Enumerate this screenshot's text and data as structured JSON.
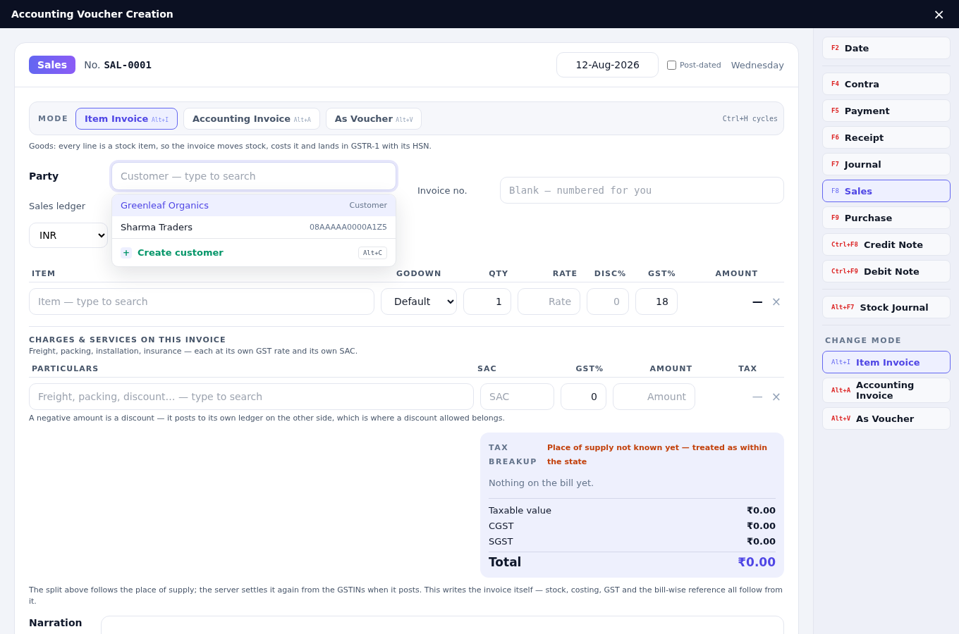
{
  "window": {
    "title": "Accounting Voucher Creation",
    "close": "×"
  },
  "header": {
    "voucher_type": "Sales",
    "number_label": "No.",
    "number": "SAL-0001",
    "date": "12-Aug-2026",
    "post_dated": {
      "label": "Post-dated",
      "checked": false
    },
    "weekday": "Wednesday"
  },
  "mode": {
    "label": "MODE",
    "options": [
      {
        "label": "Item Invoice",
        "shortcut": "Alt+I",
        "selected": true
      },
      {
        "label": "Accounting Invoice",
        "shortcut": "Alt+A",
        "selected": false
      },
      {
        "label": "As Voucher",
        "shortcut": "Alt+V",
        "selected": false
      }
    ],
    "hint": "Ctrl+H cycles",
    "description": "Goods: every line is a stock item, so the invoice moves stock, costs it and lands in GSTR-1 with its HSN."
  },
  "party": {
    "label": "Party",
    "placeholder": "Customer — type to search",
    "suggestions": [
      {
        "name": "Greenleaf Organics",
        "detail": "Customer",
        "selected": true
      },
      {
        "name": "Sharma Traders",
        "detail": "08AAAAA0000A1Z5",
        "selected": false
      }
    ],
    "create": {
      "icon": "+",
      "label": "Create customer",
      "shortcut": "Alt+C"
    }
  },
  "sales_ledger": {
    "label": "Sales ledger"
  },
  "invoice_no": {
    "label": "Invoice no.",
    "placeholder": "Blank — numbered for you"
  },
  "currency": "INR",
  "items": {
    "columns": [
      "ITEM",
      "GODOWN",
      "QTY",
      "RATE",
      "DISC%",
      "GST%",
      "AMOUNT"
    ],
    "row": {
      "item_placeholder": "Item — type to search",
      "godown": "Default",
      "qty": "1",
      "rate_placeholder": "Rate",
      "disc_placeholder": "0",
      "gst": "18",
      "amount": "—",
      "remove": "×"
    }
  },
  "charges": {
    "title": "CHARGES & SERVICES ON THIS INVOICE",
    "description": "Freight, packing, installation, insurance — each at its own GST rate and its own SAC.",
    "columns": [
      "PARTICULARS",
      "SAC",
      "GST%",
      "AMOUNT",
      "TAX"
    ],
    "row": {
      "particulars_placeholder": "Freight, packing, discount… — type to search",
      "sac_placeholder": "SAC",
      "gst": "0",
      "amount_placeholder": "Amount",
      "tax": "—",
      "remove": "×"
    },
    "note": "A negative amount is a discount — it posts to its own ledger on the other side, which is where a discount allowed belongs."
  },
  "tax_breakup": {
    "title": "TAX BREAKUP",
    "warning": "Place of supply not known yet — treated as within the state",
    "empty": "Nothing on the bill yet.",
    "lines": [
      {
        "label": "Taxable value",
        "value": "₹0.00"
      },
      {
        "label": "CGST",
        "value": "₹0.00"
      },
      {
        "label": "SGST",
        "value": "₹0.00"
      }
    ],
    "total": {
      "label": "Total",
      "value": "₹0.00"
    }
  },
  "footnote": "The split above follows the place of supply; the server settles it again from the GSTINs when it posts. This writes the invoice itself — stock, costing, GST and the bill-wise reference all follow from it.",
  "narration": {
    "label": "Narration"
  },
  "sidebar": {
    "groups": [
      {
        "items": [
          {
            "key": "F2",
            "label": "Date",
            "selected": false
          }
        ]
      },
      {
        "items": [
          {
            "key": "F4",
            "label": "Contra",
            "selected": false
          },
          {
            "key": "F5",
            "label": "Payment",
            "selected": false
          },
          {
            "key": "F6",
            "label": "Receipt",
            "selected": false
          },
          {
            "key": "F7",
            "label": "Journal",
            "selected": false
          },
          {
            "key": "F8",
            "label": "Sales",
            "selected": true
          },
          {
            "key": "F9",
            "label": "Purchase",
            "selected": false
          },
          {
            "key": "Ctrl+F8",
            "label": "Credit Note",
            "selected": false
          },
          {
            "key": "Ctrl+F9",
            "label": "Debit Note",
            "selected": false
          }
        ]
      },
      {
        "items": [
          {
            "key": "Alt+F7",
            "label": "Stock Journal",
            "selected": false
          }
        ]
      },
      {
        "heading": "CHANGE MODE",
        "items": [
          {
            "key": "Alt+I",
            "label": "Item Invoice",
            "selected": true
          },
          {
            "key": "Alt+A",
            "label": "Accounting Invoice",
            "selected": false
          },
          {
            "key": "Alt+V",
            "label": "As Voucher",
            "selected": false
          }
        ]
      }
    ]
  }
}
